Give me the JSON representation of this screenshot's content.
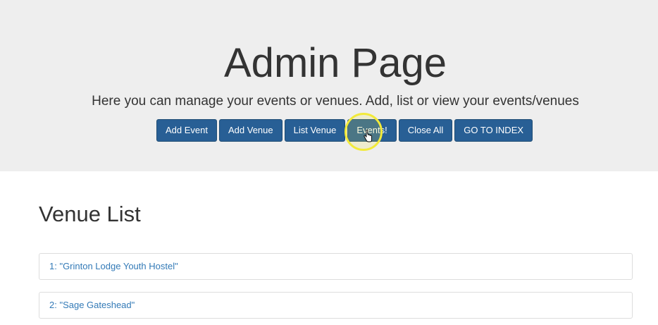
{
  "header": {
    "title": "Admin Page",
    "lead": "Here you can manage your events or venues. Add, list or view your events/venues"
  },
  "buttons": [
    {
      "label": "Add Event"
    },
    {
      "label": "Add Venue"
    },
    {
      "label": "List Venue"
    },
    {
      "label": "Events!"
    },
    {
      "label": "Close All"
    },
    {
      "label": "GO TO INDEX"
    }
  ],
  "venue_list": {
    "title": "Venue List",
    "items": [
      {
        "label": "1: \"Grinton Lodge Youth Hostel\""
      },
      {
        "label": "2: \"Sage Gateshead\""
      }
    ]
  },
  "colors": {
    "button": "#285f95",
    "link": "#337ab7",
    "jumbotron": "#eeeeee"
  }
}
